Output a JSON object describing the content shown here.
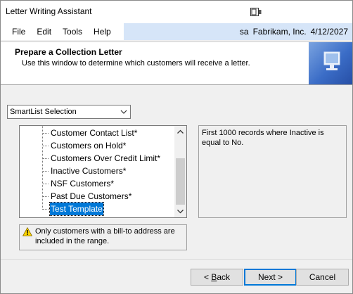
{
  "window": {
    "title": "Letter Writing Assistant",
    "icon": "window-restore-icon"
  },
  "menu": {
    "items": [
      "File",
      "Edit",
      "Tools",
      "Help"
    ],
    "user": "sa",
    "company": "Fabrikam, Inc.",
    "date": "4/12/2027",
    "highlight_color": "#d6e5f8"
  },
  "header": {
    "title": "Prepare a Collection Letter",
    "subtitle": "Use this window to determine which customers will receive a letter.",
    "graphic": "computer-monitor-icon"
  },
  "selector": {
    "value": "SmartList Selection"
  },
  "list": {
    "items": [
      {
        "label": "Customer Contact List*",
        "selected": false
      },
      {
        "label": "Customers on Hold*",
        "selected": false
      },
      {
        "label": "Customers Over Credit Limit*",
        "selected": false
      },
      {
        "label": "Inactive Customers*",
        "selected": false
      },
      {
        "label": "NSF Customers*",
        "selected": false
      },
      {
        "label": "Past Due Customers*",
        "selected": false
      },
      {
        "label": "Test Template",
        "selected": true
      }
    ],
    "selection_color": "#0078d7"
  },
  "description": "First 1000 records where Inactive is equal to No.",
  "notice": {
    "icon": "warning-icon",
    "text": "Only customers with a bill-to address are included in the range."
  },
  "buttons": {
    "back": {
      "prefix": "< ",
      "mnemonic": "B",
      "rest": "ack"
    },
    "next": {
      "label": "Next >"
    },
    "cancel": {
      "label": "Cancel"
    }
  }
}
